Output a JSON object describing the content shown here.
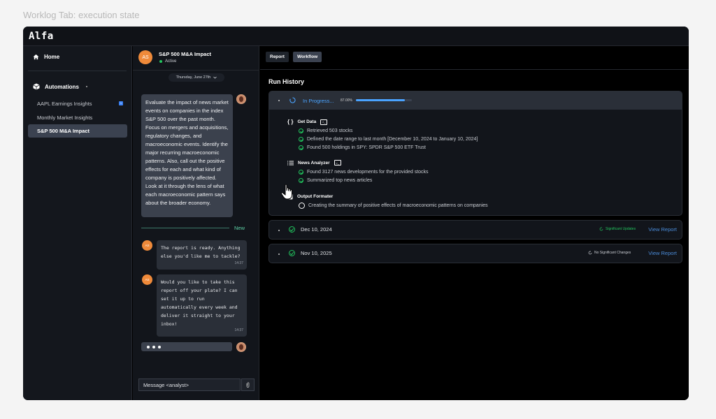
{
  "caption": "Worklog Tab: execution state",
  "app": {
    "logo": "Alfa"
  },
  "sidebar": {
    "home": "Home",
    "automations": "Automations",
    "items": [
      {
        "label": "AAPL Earnings Insights",
        "badge": "1"
      },
      {
        "label": "Monthly Market Insights"
      },
      {
        "label": "S&P 500 M&A Impact",
        "active": true
      }
    ]
  },
  "chat": {
    "avatar_initials": "AS",
    "title": "S&P 500 M&A Impact",
    "status": "Active",
    "date": "Thursday, June 27th",
    "user_message": "Evaluate the impact of news market events on companies in the index S&P 500 over the past month. Focus on mergers and acquisitions, regulatory changes, and macroeconomic events. Identify the major recurring macroeconomic patterns. Also, call out the positive effects for each and what kind of company is positively affected. Look at it through the lens of what each macroeconomic pattern says about the broader economy.",
    "new_label": "New",
    "bot_messages": [
      {
        "avatar": "AS",
        "text": "The report is ready. Anything else you'd like me to tackle?",
        "time": "14:37"
      },
      {
        "avatar": "AS",
        "text": "Would you like to take this report off your plate? I can set it up to run automatically every week and deliver it straight to your inbox!",
        "time": "14:37"
      }
    ],
    "input_placeholder": "Message <analyst>"
  },
  "main": {
    "tabs": [
      "Report",
      "Workflow"
    ],
    "active_tab": "Workflow",
    "run_history_title": "Run History",
    "current_run": {
      "status": "In Progress...",
      "progress_label": "87.00%",
      "progress": 0.87,
      "steps": [
        {
          "title": "Get Data",
          "items": [
            "Retrieved 503 stocks",
            "Defined the date range to last month [December 10, 2024 to January 10, 2024]",
            "Found 500 holdings in SPY: SPDR S&P 500 ETF Trust"
          ]
        },
        {
          "title": "News Analyzer",
          "items": [
            "Found 3127 news developments for the provided stocks",
            "Summarized top news articles"
          ]
        },
        {
          "title": "Output Formater",
          "items": [
            "Creating the summary of positive effects of macroeconomic patterns on companies"
          ]
        }
      ]
    },
    "past_runs": [
      {
        "date": "Dec 10, 2024",
        "status": "Significant Updates",
        "status_color": "#22c55e",
        "link": "View Report"
      },
      {
        "date": "Nov 10, 2025",
        "status": "No Significant Changes",
        "status_color": "#c9ccd2",
        "link": "View Report"
      }
    ]
  },
  "colors": {
    "accent": "#4aa3ff",
    "success": "#22c55e",
    "avatar": "#ef8a3a"
  }
}
